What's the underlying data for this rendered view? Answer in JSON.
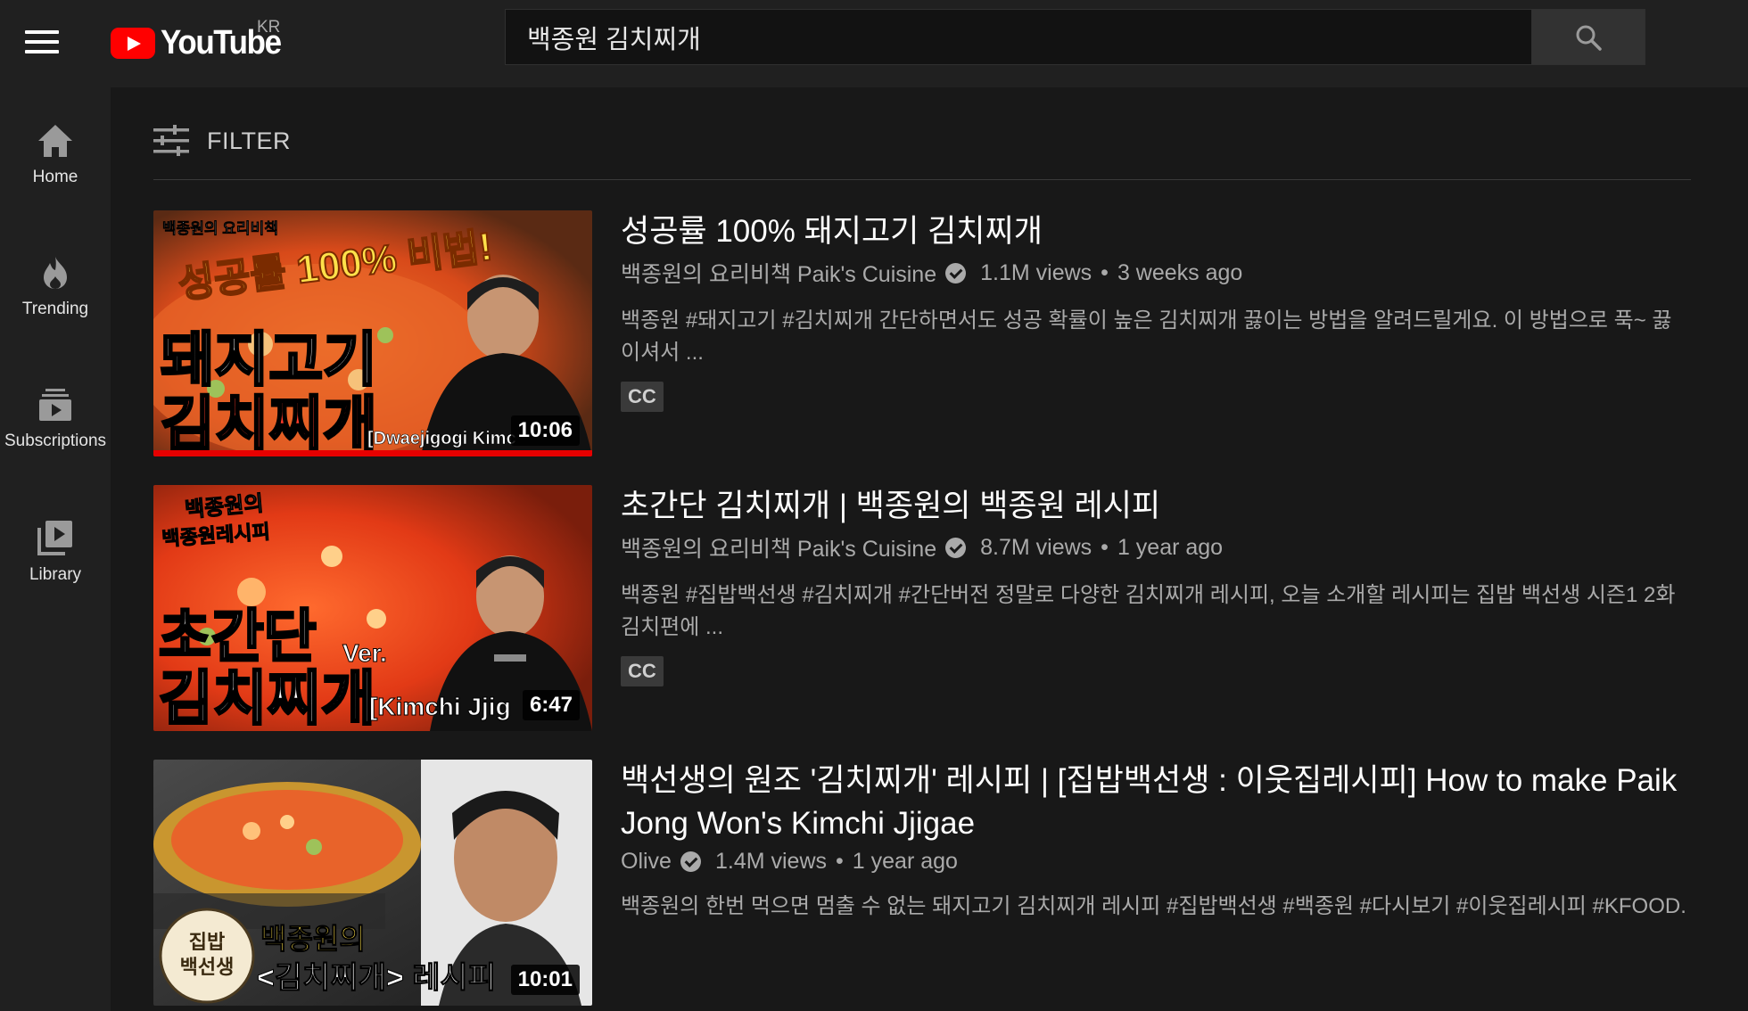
{
  "header": {
    "logo_text": "YouTube",
    "region": "KR",
    "search_value": "백종원 김치찌개"
  },
  "sidebar": {
    "items": [
      {
        "label": "Home",
        "icon": "home-icon"
      },
      {
        "label": "Trending",
        "icon": "flame-icon"
      },
      {
        "label": "Subscriptions",
        "icon": "subscriptions-icon"
      },
      {
        "label": "Library",
        "icon": "library-icon"
      }
    ]
  },
  "filter": {
    "label": "FILTER"
  },
  "results": [
    {
      "title": "성공률 100% 돼지고기 김치찌개",
      "channel": "백종원의 요리비책 Paik's Cuisine",
      "views": "1.1M views",
      "age": "3 weeks ago",
      "description": "백종원 #돼지고기 #김치찌개 간단하면서도 성공 확률이 높은 김치찌개 끓이는 방법을 알려드릴게요. 이 방법으로 푹~ 끓이셔서 ...",
      "badge": "CC",
      "duration": "10:06",
      "thumb": {
        "tag": "백종원의 요리비책",
        "headline": "성공률 100% 비법!",
        "big1": "돼지고기",
        "big2": "김치찌개",
        "sub": "[Dwaejigogi Kimc"
      }
    },
    {
      "title": "초간단 김치찌개 | 백종원의 백종원 레시피",
      "channel": "백종원의 요리비책 Paik's Cuisine",
      "views": "8.7M views",
      "age": "1 year ago",
      "description": "백종원 #집밥백선생 #김치찌개 #간단버전 정말로 다양한 김치찌개 레시피, 오늘 소개할 레시피는 집밥 백선생 시즌1 2화 김치편에 ...",
      "badge": "CC",
      "duration": "6:47",
      "thumb": {
        "tag1": "백종원의",
        "tag2": "백종원레시피",
        "big1": "초간단",
        "ver": "Ver.",
        "big2": "김치찌개",
        "sub": "[Kimchi Jjig"
      }
    },
    {
      "title": "백선생의 원조 '김치찌개' 레시피 | [집밥백선생 : 이웃집레시피] How to make Paik Jong Won's Kimchi Jjigae",
      "channel": "Olive",
      "views": "1.4M views",
      "age": "1 year ago",
      "description": "백종원의 한번 먹으면 멈출 수 없는 돼지고기 김치찌개 레시피 #집밥백선생 #백종원 #다시보기 #이웃집레시피 #KFOOD.",
      "duration": "10:01",
      "thumb": {
        "stamp_top": "집밥",
        "stamp_bottom": "백선생",
        "line1": "백종원의",
        "line2": "<김치찌개> 레시피"
      }
    }
  ]
}
